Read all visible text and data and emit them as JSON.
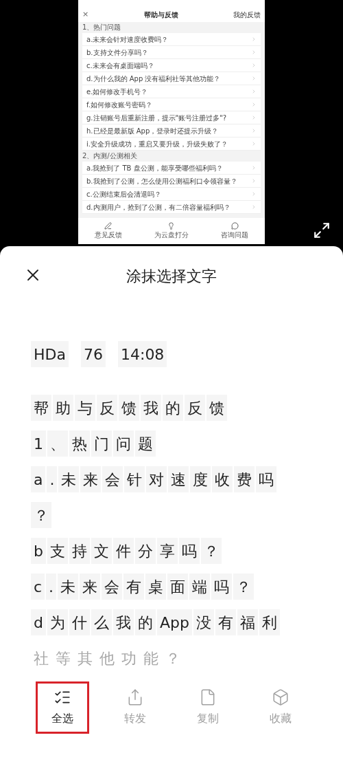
{
  "shared_screenshot": {
    "header": {
      "close": "×",
      "title": "帮助与反馈",
      "link": "我的反馈"
    },
    "sections": [
      {
        "title": "1、热门问题",
        "items": [
          "a.未来会针对速度收费吗？",
          "b.支持文件分享吗？",
          "c.未来会有桌面端吗？",
          "d.为什么我的 App 没有福利社等其他功能？",
          "e.如何修改手机号？",
          "f.如何修改账号密码？",
          "g.注销账号后重新注册，提示\"账号注册过多\"?",
          "h.已经是最新版 App，登录时还提示升级？",
          "i.安全升级成功，重启又要升级，升级失败了？"
        ]
      },
      {
        "title": "2、内测/公测相关",
        "items": [
          "a.我抢到了 TB 盘公测，能享受哪些福利吗？",
          "b.我抢到了公测，怎么使用公测福利口令领容量？",
          "c.公测结束后会清退吗？",
          "d.内测用户，抢到了公测，有二倍容量福利吗？"
        ]
      }
    ],
    "bottom_bar": [
      {
        "kind": "pen",
        "label": "意见反馈"
      },
      {
        "kind": "bulb",
        "label": "为云盘打分"
      },
      {
        "kind": "chat",
        "label": "咨询问题"
      }
    ]
  },
  "sheet": {
    "title": "涂抹选择文字",
    "lines": [
      {
        "faded": false,
        "tokens": [
          "HDa",
          "76",
          "14:08"
        ]
      },
      {
        "faded": false,
        "tokens": [
          "帮",
          "助",
          "与",
          "反",
          "馈",
          "我",
          "的",
          "反",
          "馈"
        ]
      },
      {
        "faded": false,
        "tokens": [
          "1",
          "、",
          "热",
          "门",
          "问",
          "题"
        ]
      },
      {
        "faded": false,
        "tokens": [
          "a",
          ".",
          "未",
          "来",
          "会",
          "针",
          "对",
          "速",
          "度",
          "收",
          "费",
          "吗"
        ]
      },
      {
        "faded": false,
        "tokens": [
          "？"
        ]
      },
      {
        "faded": false,
        "tokens": [
          "b",
          "支",
          "持",
          "文",
          "件",
          "分",
          "享",
          "吗",
          "？"
        ]
      },
      {
        "faded": false,
        "tokens": [
          "c",
          ".",
          "未",
          "来",
          "会",
          "有",
          "桌",
          "面",
          "端",
          "吗",
          "？"
        ]
      },
      {
        "faded": false,
        "tokens": [
          "d",
          "为",
          "什",
          "么",
          "我",
          "的",
          "App",
          "没",
          "有",
          "福",
          "利"
        ]
      },
      {
        "faded": true,
        "tokens": [
          "社",
          "等",
          "其",
          "他",
          "功",
          "能",
          "？"
        ]
      }
    ],
    "actions": [
      {
        "kind": "select_all",
        "label": "全选",
        "disabled": false,
        "highlighted": true
      },
      {
        "kind": "share",
        "label": "转发",
        "disabled": true,
        "highlighted": false
      },
      {
        "kind": "copy",
        "label": "复制",
        "disabled": true,
        "highlighted": false
      },
      {
        "kind": "favorite",
        "label": "收藏",
        "disabled": true,
        "highlighted": false
      }
    ]
  }
}
